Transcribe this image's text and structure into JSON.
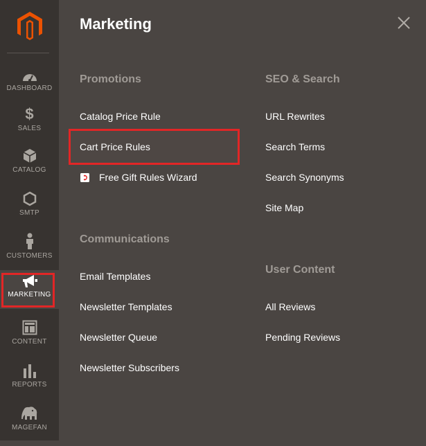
{
  "sidebar": {
    "logo_icon": "magento-logo-icon",
    "items": [
      {
        "label": "DASHBOARD",
        "icon": "dashboard-icon"
      },
      {
        "label": "SALES",
        "icon": "dollar-icon"
      },
      {
        "label": "CATALOG",
        "icon": "cube-icon"
      },
      {
        "label": "SMTP",
        "icon": "hexagon-icon"
      },
      {
        "label": "CUSTOMERS",
        "icon": "person-icon"
      },
      {
        "label": "MARKETING",
        "icon": "megaphone-icon",
        "active": true
      },
      {
        "label": "CONTENT",
        "icon": "layout-icon"
      },
      {
        "label": "REPORTS",
        "icon": "bar-chart-icon"
      },
      {
        "label": "MAGEFAN",
        "icon": "elephant-icon"
      }
    ]
  },
  "panel": {
    "title": "Marketing",
    "close_icon": "close-icon",
    "promotions": {
      "title": "Promotions",
      "links": [
        "Catalog Price Rule",
        "Cart Price Rules",
        "Free Gift Rules Wizard"
      ]
    },
    "communications": {
      "title": "Communications",
      "links": [
        "Email Templates",
        "Newsletter Templates",
        "Newsletter Queue",
        "Newsletter Subscribers"
      ]
    },
    "seo_search": {
      "title": "SEO & Search",
      "links": [
        "URL Rewrites",
        "Search Terms",
        "Search Synonyms",
        "Site Map"
      ]
    },
    "user_content": {
      "title": "User Content",
      "links": [
        "All Reviews",
        "Pending Reviews"
      ]
    }
  },
  "colors": {
    "sidebar_bg": "#373330",
    "panel_bg": "#4a4542",
    "brand_orange": "#eb5202",
    "highlight_red": "#e22626"
  }
}
